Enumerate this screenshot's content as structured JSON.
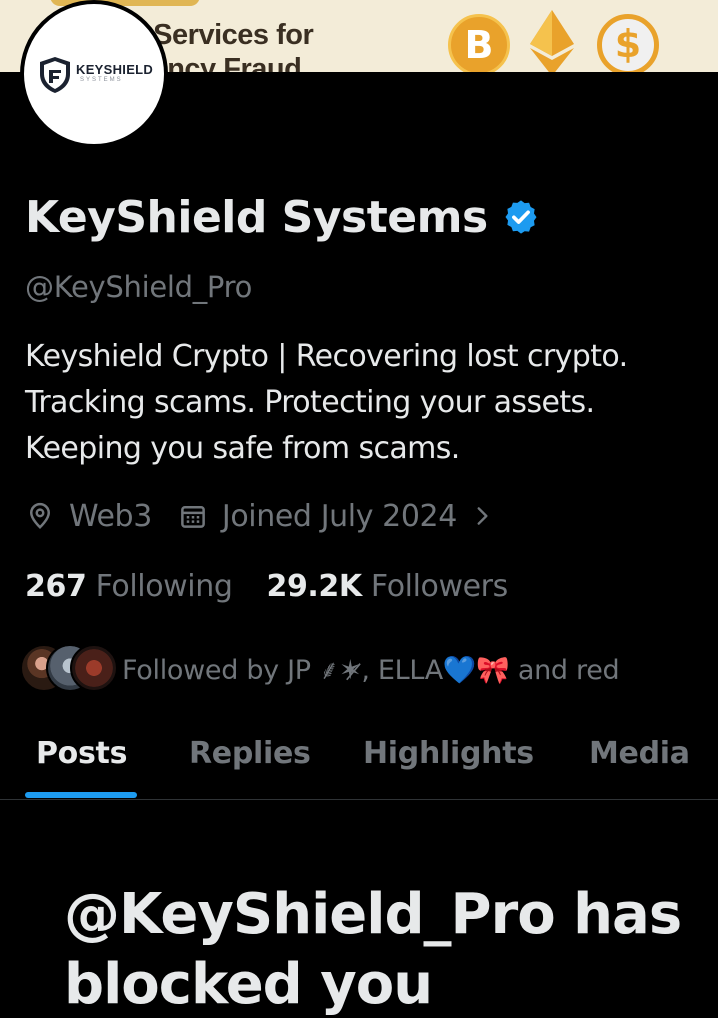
{
  "banner": {
    "text_line1": "y Services for",
    "text_line2": "rrency Fraud",
    "coins": [
      "B",
      "♦",
      "$"
    ]
  },
  "avatar": {
    "logo_text": "KEYSHIELD",
    "logo_subtext": "SYSTEMS"
  },
  "profile": {
    "display_name": "KeyShield Systems",
    "handle": "@KeyShield_Pro",
    "bio_lines": [
      "Keyshield Crypto | Recovering lost crypto.",
      "Tracking scams. Protecting your assets.",
      "Keeping you safe from scams."
    ],
    "location": "Web3",
    "joined": "Joined July 2024",
    "following_count": "267",
    "following_label": "Following",
    "followers_count": "29.2K",
    "followers_label": "Followers",
    "followed_by": "Followed by JP ⸙⁣✶̷, ELLA💙🎀 and red"
  },
  "tabs": [
    {
      "label": "Posts",
      "active": true
    },
    {
      "label": "Replies",
      "active": false
    },
    {
      "label": "Highlights",
      "active": false
    },
    {
      "label": "Media",
      "active": false
    }
  ],
  "blocked": {
    "line1": "@KeyShield_Pro has",
    "line2": "blocked you"
  },
  "colors": {
    "background": "#000000",
    "text_primary": "#e7e9ea",
    "text_secondary": "#71767b",
    "accent": "#1d9bf0",
    "banner_bg": "#f3ecd8",
    "coin_gold": "#e9a22b"
  },
  "icons": {
    "location": "location-pin-icon",
    "calendar": "calendar-icon",
    "chevron": "chevron-right-icon",
    "verified": "verified-badge-icon"
  }
}
